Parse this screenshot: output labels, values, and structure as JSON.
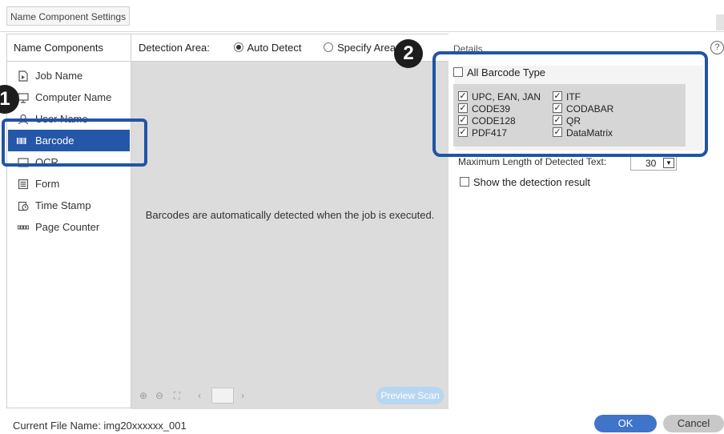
{
  "window": {
    "title": "Name Component Settings"
  },
  "sidebar": {
    "header": "Name Components",
    "items": [
      {
        "label": "Job Name",
        "icon": "document-icon",
        "selected": false
      },
      {
        "label": "Computer Name",
        "icon": "computer-icon",
        "selected": false
      },
      {
        "label": "User Name",
        "icon": "user-icon",
        "selected": false
      },
      {
        "label": "Barcode",
        "icon": "barcode-icon",
        "selected": true
      },
      {
        "label": "OCR",
        "icon": "ocr-icon",
        "selected": false
      },
      {
        "label": "Form",
        "icon": "form-icon",
        "selected": false
      },
      {
        "label": "Time Stamp",
        "icon": "clock-icon",
        "selected": false
      },
      {
        "label": "Page Counter",
        "icon": "counter-icon",
        "selected": false
      }
    ]
  },
  "detection": {
    "label": "Detection Area:",
    "auto_label": "Auto Detect",
    "specify_label": "Specify Area",
    "selected": "auto"
  },
  "preview": {
    "message": "Barcodes are automatically detected when the job is executed.",
    "scan_button": "Preview Scan",
    "page_number": ""
  },
  "details": {
    "label": "Details",
    "all_barcode_label": "All Barcode Type",
    "all_barcode_checked": false,
    "barcode_types": [
      {
        "label": "UPC, EAN, JAN",
        "checked": true
      },
      {
        "label": "ITF",
        "checked": true
      },
      {
        "label": "CODE39",
        "checked": true
      },
      {
        "label": "CODABAR",
        "checked": true
      },
      {
        "label": "CODE128",
        "checked": true
      },
      {
        "label": "QR",
        "checked": true
      },
      {
        "label": "PDF417",
        "checked": true
      },
      {
        "label": "DataMatrix",
        "checked": true
      }
    ],
    "max_length_label": "Maximum Length of Detected Text:",
    "max_length_value": "30",
    "show_result_label": "Show the detection result",
    "show_result_checked": false
  },
  "callouts": {
    "one": "1",
    "two": "2"
  },
  "footer": {
    "file_name": "Current File Name: img20xxxxxx_001",
    "ok_label": "OK",
    "cancel_label": "Cancel"
  },
  "colors": {
    "accent": "#2457a8",
    "callout_border": "#2154a5",
    "ok_button": "#3f74c8",
    "preview_scan": "#b7d6f1"
  }
}
